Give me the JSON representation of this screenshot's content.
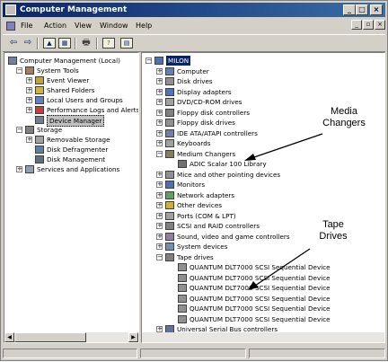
{
  "window": {
    "title": "Computer Management"
  },
  "title_buttons": [
    "_",
    "□",
    "×"
  ],
  "menu": [
    "File",
    "Action",
    "View",
    "Window",
    "Help"
  ],
  "mdi_buttons": [
    "_",
    "▫",
    "×"
  ],
  "left_tree": [
    {
      "label": "Computer Management (Local)",
      "icon": "computer-management-icon"
    },
    {
      "label": "System Tools",
      "icon": "tools-icon"
    },
    {
      "label": "Event Viewer",
      "icon": "event-viewer-icon"
    },
    {
      "label": "Shared Folders",
      "icon": "folder-icon"
    },
    {
      "label": "Local Users and Groups",
      "icon": "users-icon"
    },
    {
      "label": "Performance Logs and Alerts",
      "icon": "performance-icon"
    },
    {
      "label": "Device Manager",
      "icon": "device-manager-icon"
    },
    {
      "label": "Storage",
      "icon": "storage-icon"
    },
    {
      "label": "Removable Storage",
      "icon": "removable-storage-icon"
    },
    {
      "label": "Disk Defragmenter",
      "icon": "defrag-icon"
    },
    {
      "label": "Disk Management",
      "icon": "disk-management-icon"
    },
    {
      "label": "Services and Applications",
      "icon": "services-icon"
    }
  ],
  "right_tree": {
    "root": "MILON",
    "categories": [
      "Computer",
      "Disk drives",
      "Display adapters",
      "DVD/CD-ROM drives",
      "Floppy disk controllers",
      "Floppy disk drives",
      "IDE ATA/ATAPI controllers",
      "Keyboards",
      "Medium Changers"
    ],
    "medium_changer_child": "ADIC Scalar 100 Library",
    "categories2": [
      "Mice and other pointing devices",
      "Monitors",
      "Network adapters",
      "Other devices",
      "Ports (COM & LPT)",
      "SCSI and RAID controllers",
      "Sound, video and game controllers",
      "System devices",
      "Tape drives"
    ],
    "tape_children": [
      "QUANTUM DLT7000 SCSI Sequential Device",
      "QUANTUM DLT7000 SCSI Sequential Device",
      "QUANTUM DLT7000 SCSI Sequential Device",
      "QUANTUM DLT7000 SCSI Sequential Device",
      "QUANTUM DLT7000 SCSI Sequential Device",
      "QUANTUM DLT7000 SCSI Sequential Device"
    ],
    "last_category": "Universal Serial Bus controllers"
  },
  "annotations": {
    "media": [
      "Media",
      "Changers"
    ],
    "tape": [
      "Tape",
      "Drives"
    ]
  },
  "colors": {
    "titlebar": "#0a246a",
    "selection": "#0a246a",
    "face": "#d4d0c8"
  }
}
